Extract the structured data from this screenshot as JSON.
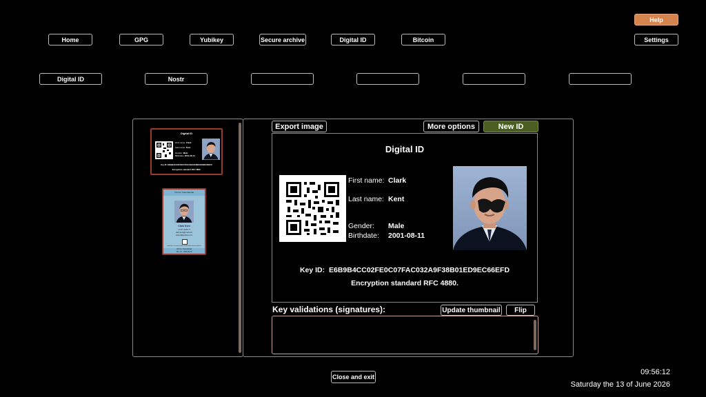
{
  "top_nav": {
    "home": "Home",
    "gpg": "GPG",
    "yubikey": "Yubikey",
    "secure_archive": "Secure archive",
    "digital_id": "Digital ID",
    "bitcoin": "Bitcoin",
    "help": "Help",
    "settings": "Settings"
  },
  "sub_nav": {
    "digital_id": "Digital ID",
    "nostr": "Nostr",
    "slot3": "",
    "slot4": "",
    "slot5": "",
    "slot6": ""
  },
  "thumbnails": {
    "card1": {
      "title": "Digital ID",
      "first_label": "First name:",
      "first_value": "Clark",
      "last_label": "Last name:",
      "last_value": "Kent",
      "gender_label": "Gender:",
      "gender_value": "Male",
      "birth_label": "Birthdate:",
      "birth_value": "2001-08-11",
      "key_line": "Key ID: E6B9B4CC02FE0C07FAC032A9F38B01ED9EC66EFD",
      "enc_line": "Encryption standard RFC 4880."
    },
    "card2": {
      "org": "Vdr Inc. International",
      "name": "Clark Kent",
      "phone": "+1 877 3346 77",
      "email": "clark.kent@mail.com",
      "web": "www.dailyplanet.com",
      "key": "E6B9B4CC02FE0C07FAC032A9F38B01ED9EC66EFD",
      "footer1": "Vdr Inc. International",
      "footer2": "Rev 1.0 · 2026-06-13"
    }
  },
  "toolbar": {
    "export": "Export image",
    "more": "More options",
    "new_id": "New ID"
  },
  "card": {
    "title": "Digital ID",
    "first_label": "First name:",
    "first_value": "Clark",
    "last_label": "Last name:",
    "last_value": "Kent",
    "gender_label": "Gender:",
    "gender_value": "Male",
    "birth_label": "Birthdate:",
    "birth_value": "2001-08-11",
    "key_label": "Key ID:",
    "key_value": "E6B9B4CC02FE0C07FAC032A9F38B01ED9EC66EFD",
    "enc_line": "Encryption standard RFC 4880."
  },
  "signatures": {
    "label": "Key validations (signatures):",
    "update": "Update thumbnail",
    "flip": "Flip"
  },
  "footer": {
    "close": "Close and exit",
    "time": "09:56:12",
    "date": "Saturday the 13 of June 2026"
  },
  "colors": {
    "accent_help": "#d5844f",
    "new_id": "#4b5e21",
    "thumb_border": "#9b3a2c"
  }
}
